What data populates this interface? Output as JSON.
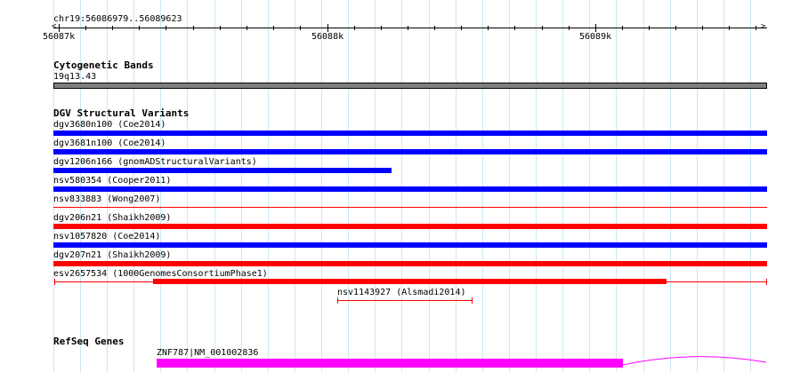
{
  "ruler": {
    "location": "chr19:56086979..56089623",
    "ticks": [
      {
        "label": "56087k"
      },
      {
        "label": "56088k"
      },
      {
        "label": "56089k"
      }
    ]
  },
  "cytobands": {
    "title": "Cytogenetic Bands",
    "band": "19q13.43"
  },
  "dgv": {
    "title": "DGV Structural Variants",
    "colors": {
      "loss": "#0000ff",
      "gain": "#ff0000",
      "mixed_line": "#ff0000"
    },
    "features": [
      {
        "name": "dgv3680n100 (Coe2014)",
        "color": "#0000ff"
      },
      {
        "name": "dgv3681n100 (Coe2014)",
        "color": "#0000ff"
      },
      {
        "name": "dgv1206n166 (gnomADStructuralVariants)",
        "color": "#0000ff"
      },
      {
        "name": "nsv580354 (Cooper2011)",
        "color": "#0000ff"
      },
      {
        "name": "nsv833883 (Wong2007)",
        "color": "#ff0000"
      },
      {
        "name": "dgv206n21 (Shaikh2009)",
        "color": "#ff0000"
      },
      {
        "name": "nsv1057820 (Coe2014)",
        "color": "#0000ff"
      },
      {
        "name": "dgv207n21 (Shaikh2009)",
        "color": "#ff0000"
      },
      {
        "name": "esv2657534 (1000GenomesConsortiumPhase1)",
        "color": "#ff0000"
      },
      {
        "name": "nsv1143927 (Alsmadi2014)",
        "color": "#ff0000"
      }
    ]
  },
  "refseq": {
    "title": "RefSeq Genes",
    "gene": "ZNF787|NM_001002836",
    "color": "#ff00ff"
  }
}
